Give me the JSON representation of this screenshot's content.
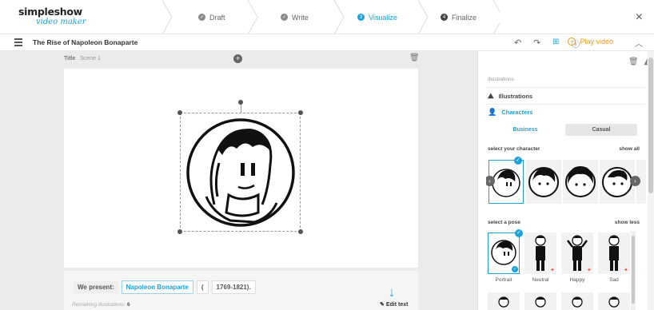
{
  "app": {
    "logo_main": "simpleshow",
    "logo_sub": "video maker",
    "close_label": "×"
  },
  "steps": [
    {
      "label": "Draft",
      "state": "done"
    },
    {
      "label": "Write",
      "state": "done"
    },
    {
      "label": "Visualize",
      "state": "active",
      "number": "3"
    },
    {
      "label": "Finalize",
      "state": "next",
      "number": "4"
    }
  ],
  "toolbar": {
    "project_title": "The Rise of Napoleon Bonaparte",
    "undo_icon": "undo-icon",
    "redo_icon": "redo-icon",
    "grid_icon": "grid-icon",
    "help_icon": "help-icon",
    "play_label": "Play video",
    "collapse_icon": "chevron-up-icon"
  },
  "scene": {
    "title_label": "Title",
    "scene_name": "Scene 1"
  },
  "textbar": {
    "present_label": "We present:",
    "highlight": "Napoleon Bonaparte",
    "open_paren": "(",
    "years": "1769-1821).",
    "remaining_label": "Remaining illustrations:",
    "remaining_count": "6",
    "edit_text": "Edit text"
  },
  "panel": {
    "section_label": "Illustrations",
    "illustrations_link": "Illustrations",
    "characters_link": "Characters",
    "toggle_business": "Business",
    "toggle_casual": "Casual",
    "select_character": "select your character",
    "show_all": "show all",
    "select_pose": "select a pose",
    "show_less": "show less",
    "poses": [
      "Portrait",
      "Neutral",
      "Happy",
      "Sad"
    ]
  },
  "colors": {
    "accent": "#1aa3d9",
    "play": "#f39a1e",
    "new_badge": "#e84e3a"
  }
}
